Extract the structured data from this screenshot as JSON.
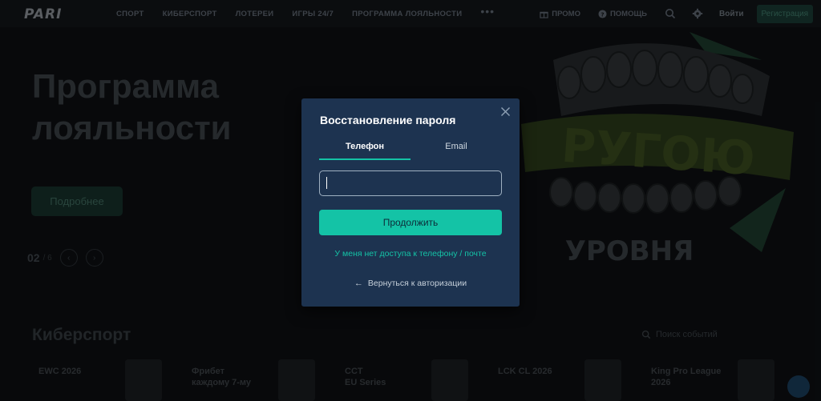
{
  "header": {
    "logo": "PARI",
    "nav": [
      "СПОРТ",
      "КИБЕРСПОРТ",
      "ЛОТЕРЕИ",
      "ИГРЫ 24/7",
      "ПРОГРАММА ЛОЯЛЬНОСТИ"
    ],
    "more": "•••",
    "promo": "ПРОМО",
    "help": "ПОМОЩЬ",
    "login": "Войти",
    "register": "Регистрация"
  },
  "hero": {
    "title_line1": "Программа",
    "title_line2": "лояльности",
    "more_button": "Подробнее",
    "slide_current": "02",
    "slide_total": "/ 6"
  },
  "esports": {
    "title": "Киберспорт",
    "search_placeholder": "Поиск событий",
    "cards": [
      {
        "line1": "EWC 2026",
        "line2": ""
      },
      {
        "line1": "Фрибет",
        "line2": "каждому 7-му"
      },
      {
        "line1": "CCT",
        "line2": "EU Series"
      },
      {
        "line1": "LCK CL 2026",
        "line2": ""
      },
      {
        "line1": "King Pro League",
        "line2": "2026"
      }
    ]
  },
  "modal": {
    "title": "Восстановление пароля",
    "tabs": [
      "Телефон",
      "Email"
    ],
    "active_tab": "Телефон",
    "phone_value": "",
    "continue_button": "Продолжить",
    "no_access_link": "У меня нет доступа к телефону / почте",
    "back_link": "Вернуться к авторизации"
  },
  "colors": {
    "accent": "#14c3a6",
    "modal_bg": "#1d3350",
    "page_bg": "#0d0f12"
  }
}
